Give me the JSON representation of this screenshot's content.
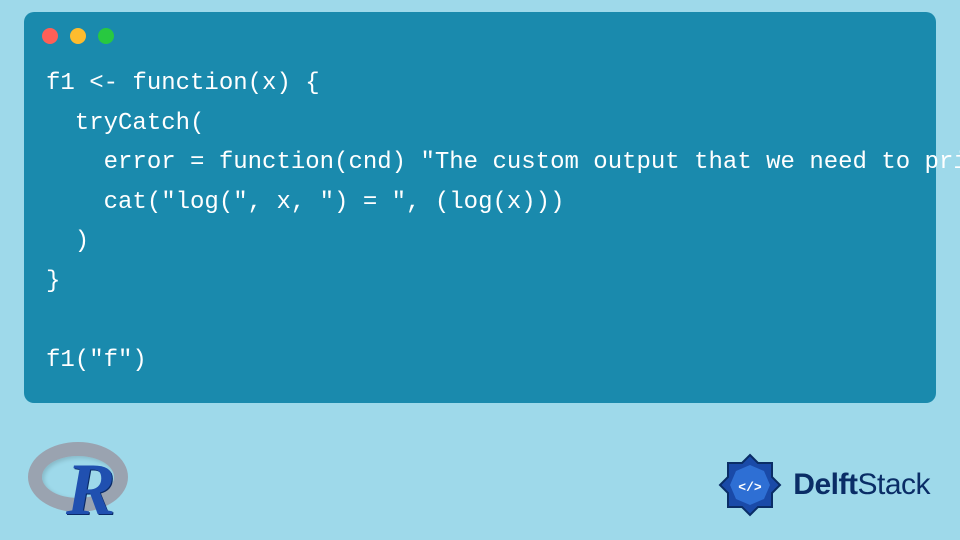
{
  "code": {
    "lines": [
      "f1 <- function(x) {",
      "  tryCatch(",
      "    error = function(cnd) \"The custom output that we need to print\",",
      "    cat(\"log(\", x, \") = \", (log(x)))",
      "  )",
      "}",
      "",
      "f1(\"f\")"
    ]
  },
  "logos": {
    "r_letter": "R",
    "delft_bold": "Delft",
    "delft_rest": "Stack"
  }
}
